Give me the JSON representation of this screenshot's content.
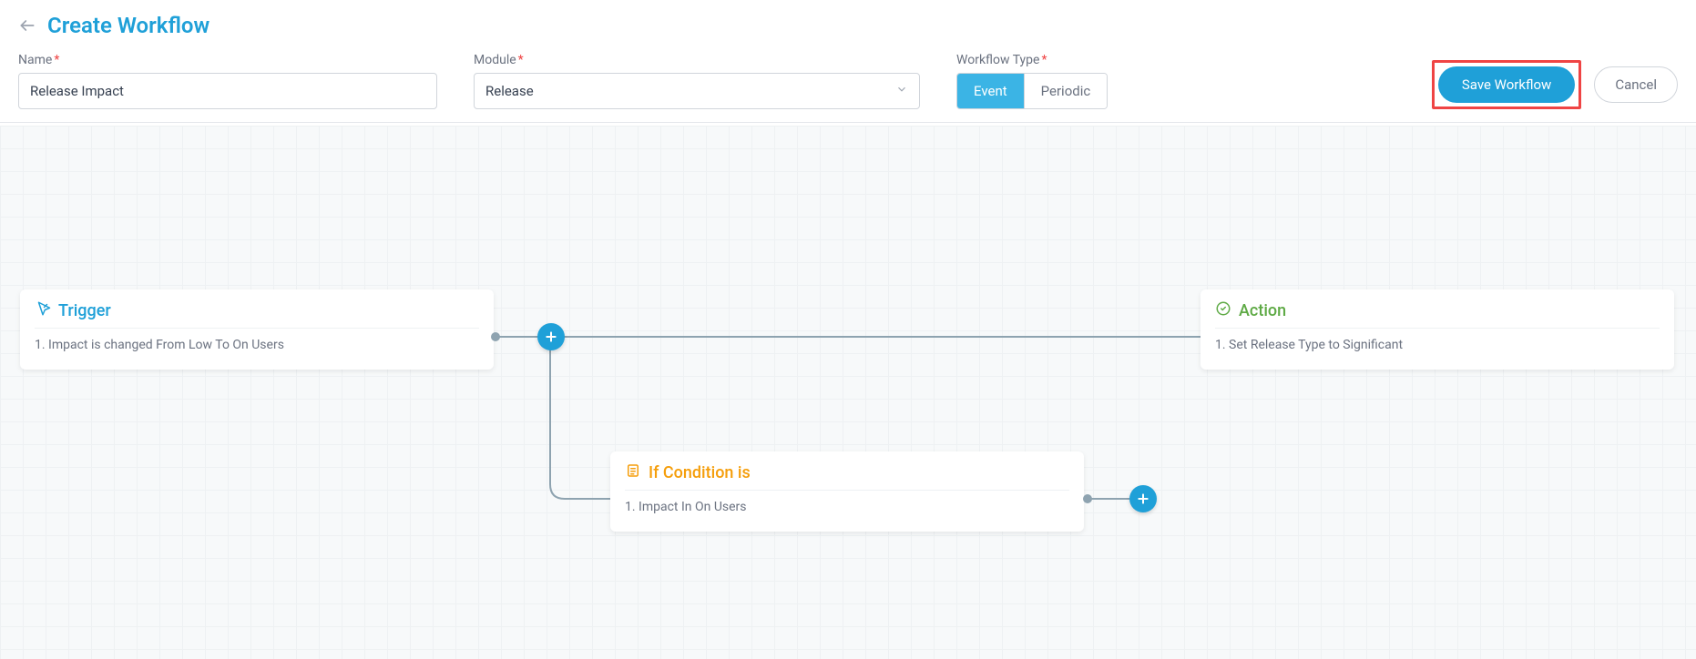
{
  "header": {
    "title": "Create Workflow",
    "name_label": "Name",
    "name_value": "Release Impact",
    "module_label": "Module",
    "module_value": "Release",
    "type_label": "Workflow Type",
    "type_event": "Event",
    "type_periodic": "Periodic",
    "save_label": "Save Workflow",
    "cancel_label": "Cancel"
  },
  "nodes": {
    "trigger": {
      "title": "Trigger",
      "line1": "1. Impact is changed From Low To On Users"
    },
    "action": {
      "title": "Action",
      "line1": "1. Set Release Type to Significant"
    },
    "condition": {
      "title": "If Condition is",
      "line1": "1. Impact In On Users"
    }
  }
}
